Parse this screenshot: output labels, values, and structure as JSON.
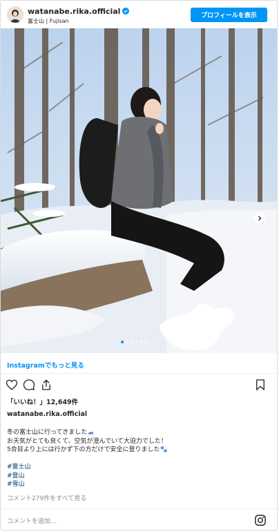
{
  "header": {
    "username": "watanabe.rika.official",
    "location": "富士山 | Fujisan",
    "profile_button": "プロフィールを表示"
  },
  "post": {
    "see_more": "Instagramでもっと見る",
    "carousel": {
      "count": 6,
      "active_index": 0
    }
  },
  "actions": {
    "icons": [
      "heart-icon",
      "comment-icon",
      "share-icon",
      "bookmark-icon"
    ]
  },
  "likes": {
    "label": "「いいね！」12,649件"
  },
  "caption": {
    "username": "watanabe.rika.official",
    "lines": [
      "冬の富士山に行ってきました🗻",
      "お天気がとても良くて、空気が澄んでいて大迫力でした！",
      "5合目より上には行かず下の方だけで安全に登りました🐾"
    ],
    "hashtags": [
      "#富士山",
      "#登山",
      "#雪山"
    ]
  },
  "comments": {
    "view_all": "コメント279件をすべて見る",
    "add_placeholder": "コメントを追加..."
  },
  "colors": {
    "accent": "#0095f6",
    "hashtag": "#00376b",
    "muted": "#8e8e8e"
  }
}
